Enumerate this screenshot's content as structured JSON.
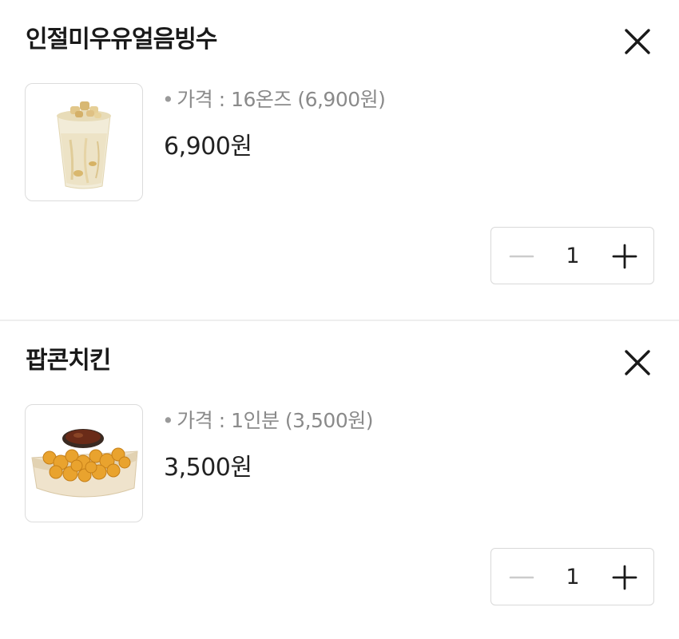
{
  "items": [
    {
      "name": "인절미우유얼음빙수",
      "option_label": "가격 : 16온즈 (6,900원)",
      "price": "6,900원",
      "quantity": "1",
      "image": "bingsu-cup",
      "icons": {
        "remove": "close-icon",
        "decrease": "minus-icon",
        "increase": "plus-icon"
      }
    },
    {
      "name": "팝콘치킨",
      "option_label": "가격 : 1인분 (3,500원)",
      "price": "3,500원",
      "quantity": "1",
      "image": "popcorn-chicken-box",
      "icons": {
        "remove": "close-icon",
        "decrease": "minus-icon",
        "increase": "plus-icon"
      }
    }
  ],
  "colors": {
    "divider": "#eeeeee",
    "disabled_icon": "#cccccc",
    "text": "#222222",
    "muted_text": "#8a8a8a"
  }
}
